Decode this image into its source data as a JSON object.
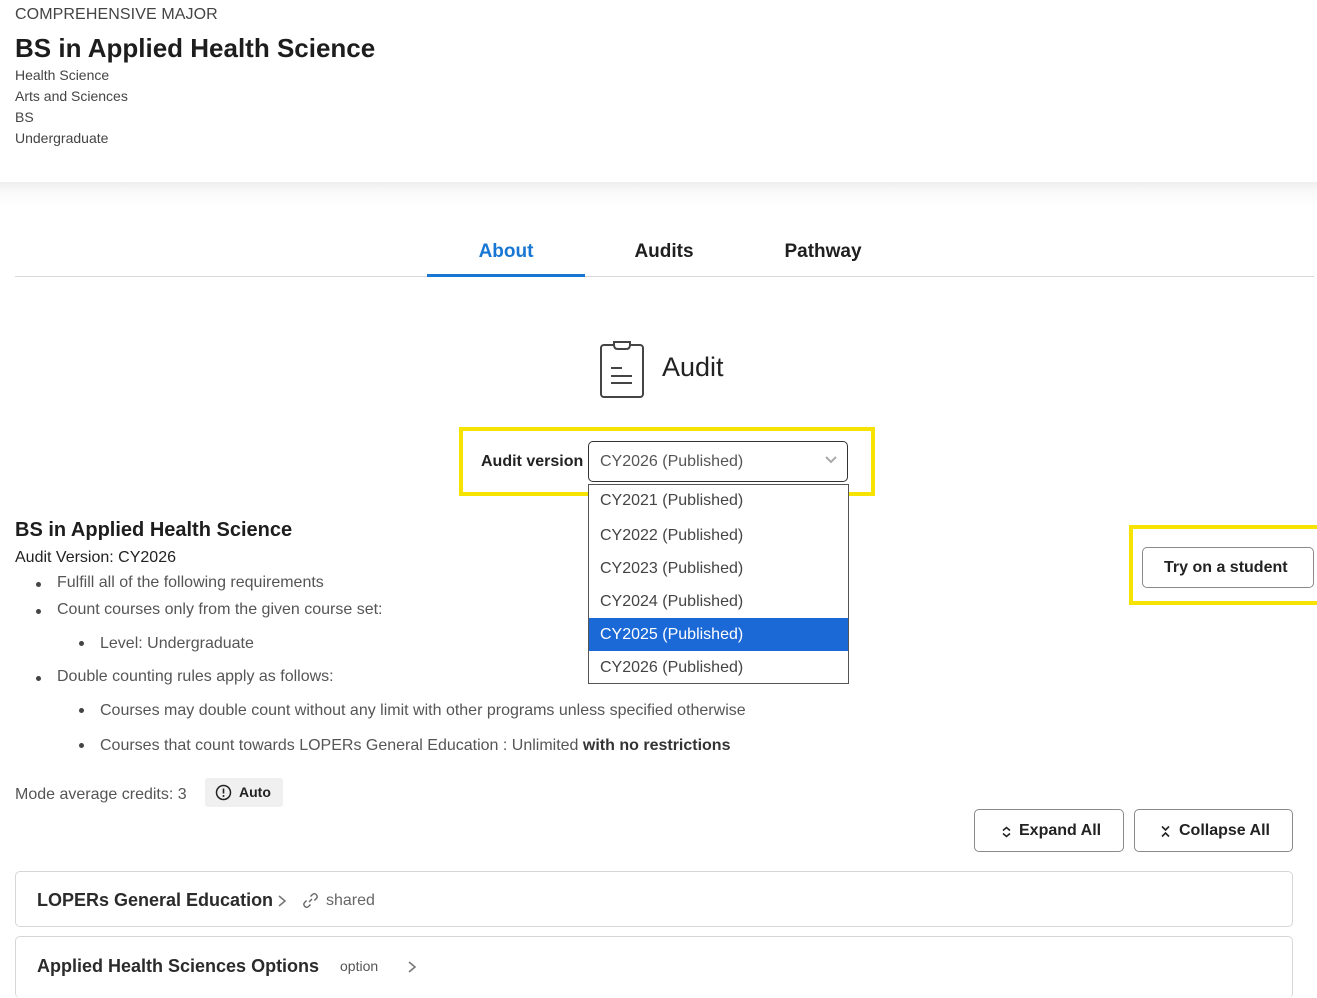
{
  "header": {
    "kicker": "COMPREHENSIVE MAJOR",
    "title": "BS in Applied Health Science",
    "meta": [
      "Health Science",
      "Arts and Sciences",
      "BS",
      "Undergraduate"
    ]
  },
  "tabs": [
    {
      "label": "About",
      "active": true
    },
    {
      "label": "Audits",
      "active": false
    },
    {
      "label": "Pathway",
      "active": false
    }
  ],
  "audit": {
    "heading": "Audit",
    "icon": "clipboard-icon",
    "version_label": "Audit version",
    "selected_version": "CY2026 (Published)",
    "dropdown_options": [
      "CY2021 (Published)",
      "CY2022 (Published)",
      "CY2023 (Published)",
      "CY2024 (Published)",
      "CY2025 (Published)",
      "CY2026 (Published)"
    ],
    "highlighted_option": "CY2025 (Published)"
  },
  "program": {
    "title": "BS in Applied Health Science",
    "version_line": "Audit Version: CY2026",
    "bullets": [
      "Fulfill all of the following requirements",
      "Count courses only from the given course set:",
      "Level: Undergraduate",
      "Double counting rules apply as follows:",
      "Courses may double count without any limit with other programs unless specified otherwise"
    ],
    "gen_ed_rule": {
      "prefix": "Courses that count towards LOPERs General Education : Unlimited ",
      "bold": "with no restrictions"
    },
    "mode_credits": "Mode average credits: 3",
    "auto_badge": "Auto"
  },
  "buttons": {
    "try_student": "Try on a student",
    "expand_all": "Expand All",
    "collapse_all": "Collapse All"
  },
  "sections": [
    {
      "title": "LOPERs General Education",
      "tag": "shared"
    },
    {
      "title": "Applied Health Sciences Options",
      "tag": "option"
    }
  ],
  "colors": {
    "accent": "#1877d2",
    "highlight": "#f6e400",
    "selected_option": "#1b69d6"
  }
}
